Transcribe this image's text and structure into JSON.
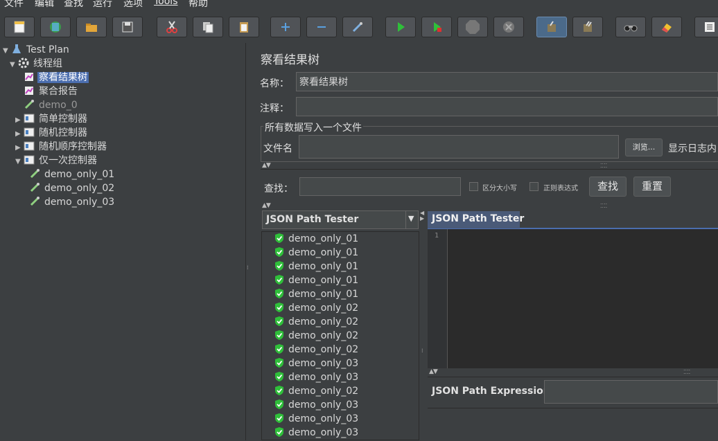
{
  "menu": [
    "文件",
    "编辑",
    "查找",
    "运行",
    "选项",
    "Tools",
    "帮助"
  ],
  "toolbar": {
    "buttons": [
      {
        "name": "new-button",
        "icon": "new-file-icon"
      },
      {
        "name": "templates-button",
        "icon": "templates-icon"
      },
      {
        "name": "open-button",
        "icon": "open-folder-icon"
      },
      {
        "name": "save-button",
        "icon": "save-icon"
      },
      {
        "name": "cut-button",
        "icon": "cut-icon"
      },
      {
        "name": "copy-button",
        "icon": "copy-icon"
      },
      {
        "name": "paste-button",
        "icon": "paste-icon"
      },
      {
        "name": "expand-button",
        "icon": "plus-icon"
      },
      {
        "name": "collapse-button",
        "icon": "minus-icon"
      },
      {
        "name": "toggle-button",
        "icon": "toggle-icon"
      },
      {
        "name": "start-button",
        "icon": "play-icon"
      },
      {
        "name": "start-no-timers-button",
        "icon": "play-no-pause-icon"
      },
      {
        "name": "stop-button",
        "icon": "stop-icon"
      },
      {
        "name": "shutdown-button",
        "icon": "shutdown-icon"
      },
      {
        "name": "clear-button",
        "icon": "broom-clear-icon"
      },
      {
        "name": "clear-all-button",
        "icon": "broom-clear-all-icon"
      },
      {
        "name": "search-button",
        "icon": "binoculars-icon"
      },
      {
        "name": "reset-search-button",
        "icon": "eraser-icon"
      },
      {
        "name": "function-helper-button",
        "icon": "list-icon"
      }
    ]
  },
  "tree": {
    "nodes": [
      {
        "label": "Test Plan",
        "icon": "flask-icon",
        "toggle": "▼"
      },
      {
        "label": "线程组",
        "icon": "gear-icon",
        "toggle": "▼"
      },
      {
        "label": "察看结果树",
        "icon": "chart-icon",
        "toggle": ""
      },
      {
        "label": "聚合报告",
        "icon": "chart-icon",
        "toggle": ""
      },
      {
        "label": "demo_0",
        "icon": "pipette-icon",
        "toggle": ""
      },
      {
        "label": "简单控制器",
        "icon": "controller-icon",
        "toggle": "▶"
      },
      {
        "label": "随机控制器",
        "icon": "controller-icon",
        "toggle": "▶"
      },
      {
        "label": "随机顺序控制器",
        "icon": "controller-icon",
        "toggle": "▶"
      },
      {
        "label": "仅一次控制器",
        "icon": "controller-icon",
        "toggle": "▼"
      },
      {
        "label": "demo_only_01",
        "icon": "pipette-icon",
        "toggle": ""
      },
      {
        "label": "demo_only_02",
        "icon": "pipette-icon",
        "toggle": ""
      },
      {
        "label": "demo_only_03",
        "icon": "pipette-icon",
        "toggle": ""
      }
    ]
  },
  "panel": {
    "title": "察看结果树",
    "name_label": "名称：",
    "name_value": "察看结果树",
    "comment_label": "注释：",
    "comment_value": "",
    "file_group_title": "所有数据写入一个文件",
    "filename_label": "文件名",
    "filename_value": "",
    "browse_label": "浏览...",
    "log_label": "显示日志内",
    "search_label": "查找：",
    "search_value": "",
    "case_sensitive_label": "区分大小写",
    "regex_label": "正则表达式",
    "find_button": "查找",
    "reset_button": "重置",
    "renderer_selected": "JSON Path Tester",
    "tab_label": "JSON Path Tester",
    "line_number": "1",
    "expression_label": "JSON Path Expression",
    "expression_value": ""
  },
  "results": [
    "demo_only_01",
    "demo_only_01",
    "demo_only_01",
    "demo_only_01",
    "demo_only_01",
    "demo_only_02",
    "demo_only_02",
    "demo_only_02",
    "demo_only_02",
    "demo_only_03",
    "demo_only_03",
    "demo_only_02",
    "demo_only_03",
    "demo_only_03",
    "demo_only_03"
  ],
  "colors": {
    "background": "#3c3f41",
    "selection": "#4b6eaf",
    "success_icon": "#2fbf3a",
    "editor_bg": "#2b2b2b"
  }
}
